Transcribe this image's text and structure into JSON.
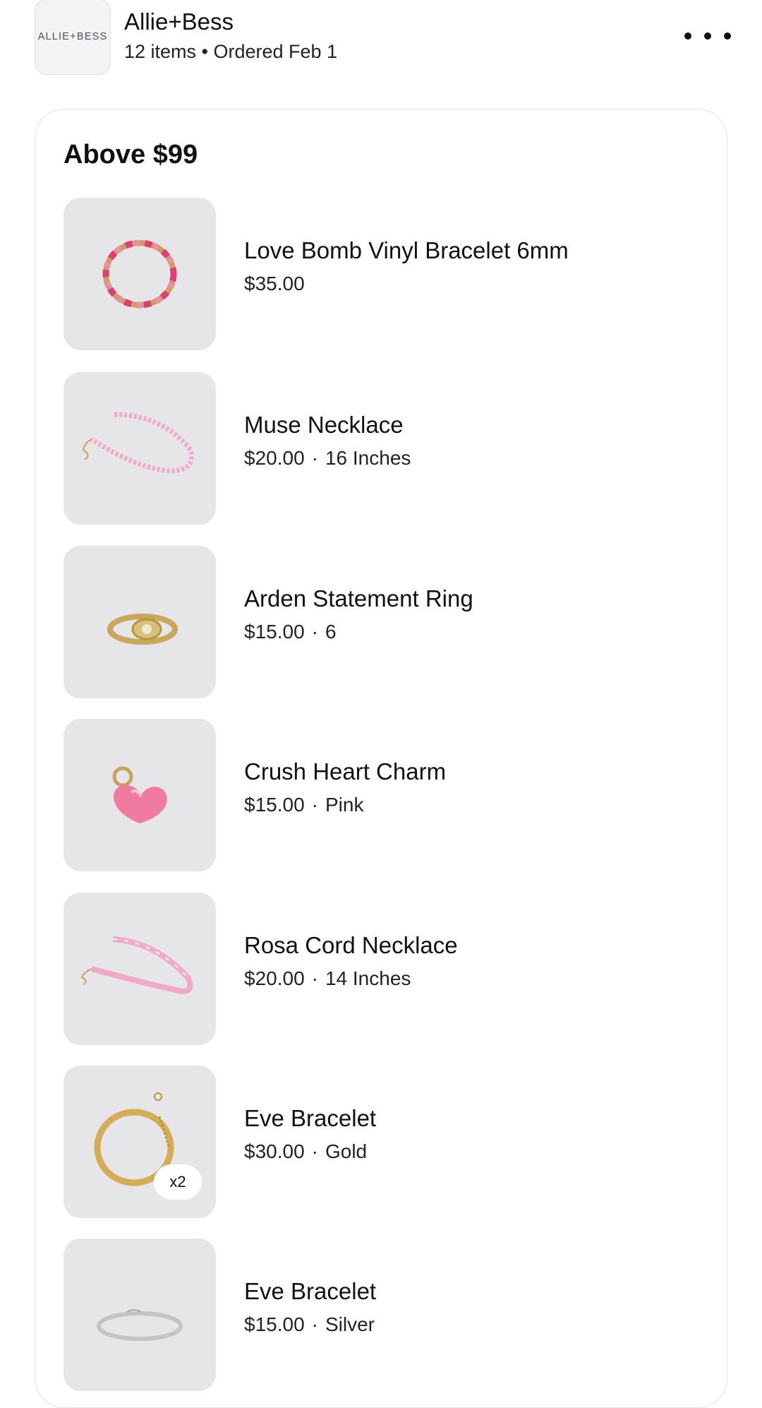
{
  "header": {
    "logo_text": "ALLIE+BESS",
    "shop_name": "Allie+Bess",
    "meta": "12 items • Ordered Feb 1"
  },
  "section": {
    "title": "Above $99"
  },
  "items": [
    {
      "name": "Love Bomb Vinyl Bracelet 6mm",
      "price": "$35.00",
      "variant": ""
    },
    {
      "name": "Muse Necklace",
      "price": "$20.00",
      "variant": "16 Inches"
    },
    {
      "name": "Arden Statement Ring",
      "price": "$15.00",
      "variant": "6"
    },
    {
      "name": "Crush Heart Charm",
      "price": "$15.00",
      "variant": "Pink"
    },
    {
      "name": "Rosa Cord Necklace",
      "price": "$20.00",
      "variant": "14 Inches"
    },
    {
      "name": "Eve Bracelet",
      "price": "$30.00",
      "variant": "Gold",
      "quantity": "x2"
    },
    {
      "name": "Eve Bracelet",
      "price": "$15.00",
      "variant": "Silver"
    }
  ],
  "separator": "·",
  "icons": {
    "more": "more-horizontal-icon"
  }
}
